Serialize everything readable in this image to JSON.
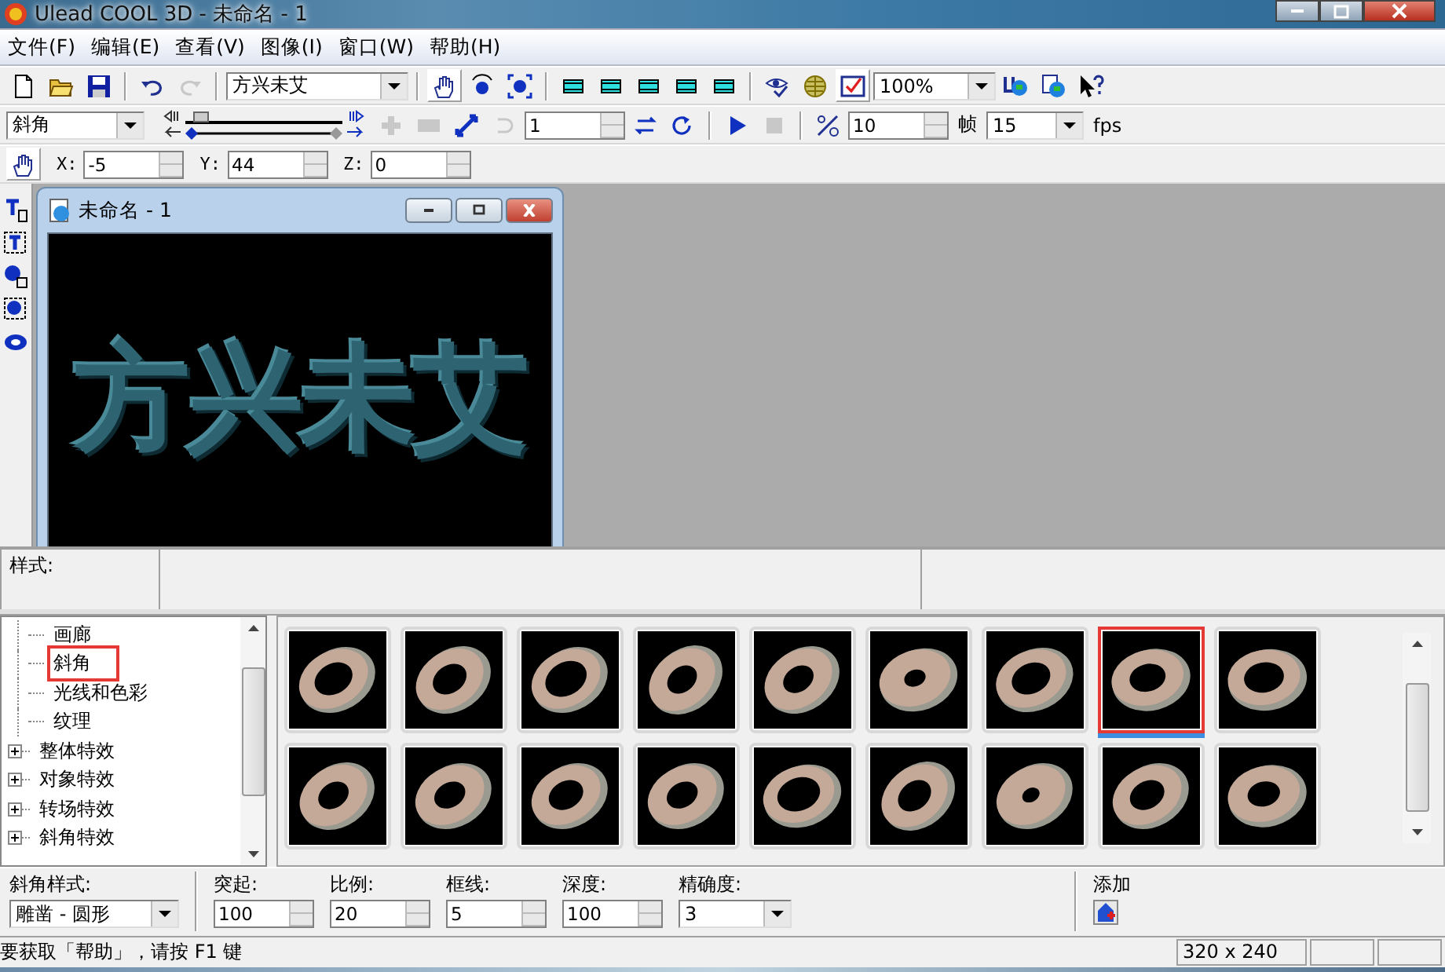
{
  "window": {
    "title": "Ulead COOL 3D - 未命名 - 1"
  },
  "menu": [
    {
      "label": "文件(F)"
    },
    {
      "label": "编辑(E)"
    },
    {
      "label": "查看(V)"
    },
    {
      "label": "图像(I)"
    },
    {
      "label": "窗口(W)"
    },
    {
      "label": "帮助(H)"
    }
  ],
  "toolbar_1": [
    {
      "kind": "button",
      "pressed": false,
      "disabled": false
    },
    {
      "kind": "button",
      "pressed": false,
      "disabled": false
    },
    {
      "kind": "button",
      "pressed": false,
      "disabled": false
    },
    {
      "kind": "separator"
    },
    {
      "kind": "button",
      "pressed": false,
      "disabled": false
    },
    {
      "kind": "button",
      "pressed": false,
      "disabled": true
    },
    {
      "kind": "separator"
    },
    {
      "kind": "dropdown",
      "value": "方兴未艾"
    },
    {
      "kind": "separator"
    },
    {
      "kind": "button",
      "pressed": true,
      "disabled": false
    },
    {
      "kind": "button",
      "pressed": false,
      "disabled": false
    },
    {
      "kind": "button",
      "pressed": false,
      "disabled": false
    },
    {
      "kind": "separator"
    },
    {
      "kind": "button",
      "pressed": false,
      "disabled": false
    },
    {
      "kind": "button",
      "pressed": false,
      "disabled": false
    },
    {
      "kind": "button",
      "pressed": false,
      "disabled": false
    },
    {
      "kind": "button",
      "pressed": false,
      "disabled": false
    },
    {
      "kind": "button",
      "pressed": false,
      "disabled": false
    },
    {
      "kind": "separator"
    },
    {
      "kind": "button",
      "pressed": false,
      "disabled": false
    },
    {
      "kind": "button",
      "pressed": false,
      "disabled": false
    },
    {
      "kind": "button",
      "pressed": true,
      "disabled": false
    },
    {
      "kind": "dropdown",
      "value": "100%"
    },
    {
      "kind": "button",
      "pressed": false,
      "disabled": false
    },
    {
      "kind": "button",
      "pressed": false,
      "disabled": false
    },
    {
      "kind": "button",
      "pressed": false,
      "disabled": false
    }
  ],
  "toolbar_2": [
    {
      "kind": "dropdown",
      "value": "斜角"
    },
    {
      "kind": "slider",
      "level": 0.05
    },
    {
      "kind": "button",
      "pressed": false,
      "disabled": true
    },
    {
      "kind": "button",
      "pressed": false,
      "disabled": true
    },
    {
      "kind": "button",
      "pressed": false,
      "disabled": false
    },
    {
      "kind": "button",
      "pressed": false,
      "disabled": true
    },
    {
      "kind": "spinner",
      "value": "1"
    },
    {
      "kind": "button",
      "pressed": false,
      "disabled": false
    },
    {
      "kind": "button",
      "pressed": false,
      "disabled": false
    },
    {
      "kind": "separator"
    },
    {
      "kind": "button",
      "pressed": false,
      "disabled": false
    },
    {
      "kind": "button",
      "pressed": false,
      "disabled": true
    },
    {
      "kind": "separator"
    },
    {
      "kind": "button",
      "pressed": false,
      "disabled": false
    },
    {
      "kind": "spinner",
      "value": "10"
    },
    {
      "kind": "label",
      "text": "帧"
    },
    {
      "kind": "dropdown",
      "value": "15"
    },
    {
      "kind": "label",
      "text": "fps"
    }
  ],
  "toolbar_3": [
    {
      "kind": "button",
      "pressed": true,
      "disabled": false
    },
    {
      "kind": "spinner",
      "label": "X:",
      "value": "-5"
    },
    {
      "kind": "spinner",
      "label": "Y:",
      "value": "44"
    },
    {
      "kind": "spinner",
      "label": "Z:",
      "value": "0"
    }
  ],
  "document": {
    "title": "未命名 - 1",
    "preview_text": "方兴未艾"
  },
  "style_bar": {
    "label": "样式:"
  },
  "tree": {
    "children": [
      {
        "label": "画廊",
        "selected": false
      },
      {
        "label": "斜角",
        "selected": true
      },
      {
        "label": "光线和色彩",
        "selected": false
      },
      {
        "label": "纹理",
        "selected": false
      }
    ],
    "items": [
      {
        "label": "整体特效",
        "expanded": false
      },
      {
        "label": "对象特效",
        "expanded": false
      },
      {
        "label": "转场特效",
        "expanded": false
      },
      {
        "label": "斜角特效",
        "expanded": false
      }
    ]
  },
  "thumbnails": [
    {
      "selected": false
    },
    {
      "selected": false
    },
    {
      "selected": false
    },
    {
      "selected": false
    },
    {
      "selected": false
    },
    {
      "selected": false
    },
    {
      "selected": false
    },
    {
      "selected": true
    },
    {
      "selected": false
    },
    {
      "selected": false
    },
    {
      "selected": false
    },
    {
      "selected": false
    },
    {
      "selected": false
    },
    {
      "selected": false
    },
    {
      "selected": false
    },
    {
      "selected": false
    },
    {
      "selected": false
    },
    {
      "selected": false
    }
  ],
  "properties": [
    {
      "kind": "dropdown",
      "label": "斜角样式:",
      "value": "雕凿 - 圆形"
    },
    {
      "kind": "spinner",
      "label": "突起:",
      "value": "100"
    },
    {
      "kind": "spinner",
      "label": "比例:",
      "value": "20"
    },
    {
      "kind": "spinner",
      "label": "框线:",
      "value": "5"
    },
    {
      "kind": "spinner",
      "label": "深度:",
      "value": "100"
    },
    {
      "kind": "dropdown",
      "label": "精确度:",
      "value": "3"
    }
  ],
  "add": {
    "label": "添加"
  },
  "status_bar": {
    "message": "要获取「帮助」，请按 F1 键",
    "size": "320 x 240"
  }
}
